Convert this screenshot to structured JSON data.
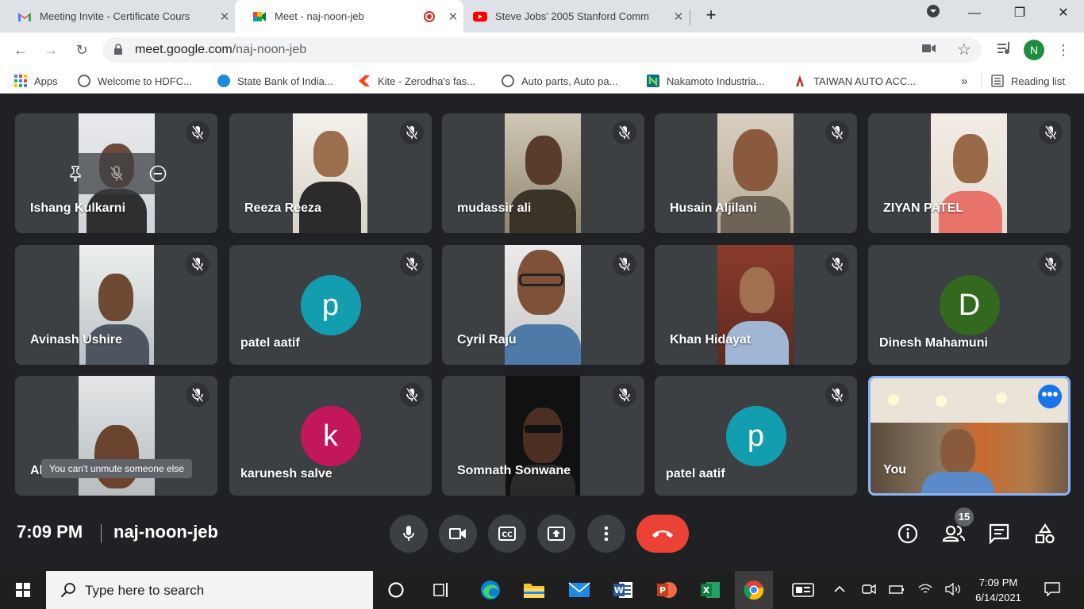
{
  "browser": {
    "tabs": [
      {
        "title": "Meeting Invite - Certificate Cours",
        "icon": "gmail-icon"
      },
      {
        "title": "Meet - naj-noon-jeb",
        "icon": "meet-icon",
        "active": true
      },
      {
        "title": "Steve Jobs' 2005 Stanford Comm",
        "icon": "youtube-icon"
      }
    ],
    "url_host": "meet.google.com",
    "url_path": "/naj-noon-jeb",
    "profile_initial": "N",
    "bookmarks": [
      {
        "label": "Apps"
      },
      {
        "label": "Welcome to HDFC..."
      },
      {
        "label": "State Bank of India..."
      },
      {
        "label": "Kite - Zerodha's fas..."
      },
      {
        "label": "Auto parts, Auto pa..."
      },
      {
        "label": "Nakamoto Industria..."
      },
      {
        "label": "TAIWAN AUTO ACC..."
      }
    ],
    "overflow": "»",
    "reading_list": "Reading list"
  },
  "meet": {
    "participants": [
      {
        "name": "Ishang Kulkarni"
      },
      {
        "name": "Reeza Reeza"
      },
      {
        "name": "mudassir ali"
      },
      {
        "name": "Husain Aljilani"
      },
      {
        "name": "ZIYAN PATEL"
      },
      {
        "name": "Avinash Ushire"
      },
      {
        "name": "patel aatif",
        "initial": "p"
      },
      {
        "name": "Cyril Raju"
      },
      {
        "name": "Khan Hidayat"
      },
      {
        "name": "Dinesh Mahamuni",
        "initial": "D"
      },
      {
        "name": "Al"
      },
      {
        "name": "karunesh salve",
        "initial": "k"
      },
      {
        "name": "Somnath Sonwane"
      },
      {
        "name": "patel aatif",
        "initial": "p"
      },
      {
        "name": "You"
      }
    ],
    "tooltip": "You can't unmute someone else",
    "time": "7:09 PM",
    "meeting_code": "naj-noon-jeb",
    "participant_count": "15",
    "colors": {
      "teal": "#129eaf",
      "pink": "#c2185b",
      "green": "#33691e",
      "end": "#ea4335",
      "self_border": "#8ab4f8"
    }
  },
  "taskbar": {
    "search_placeholder": "Type here to search",
    "time": "7:09 PM",
    "date": "6/14/2021"
  }
}
